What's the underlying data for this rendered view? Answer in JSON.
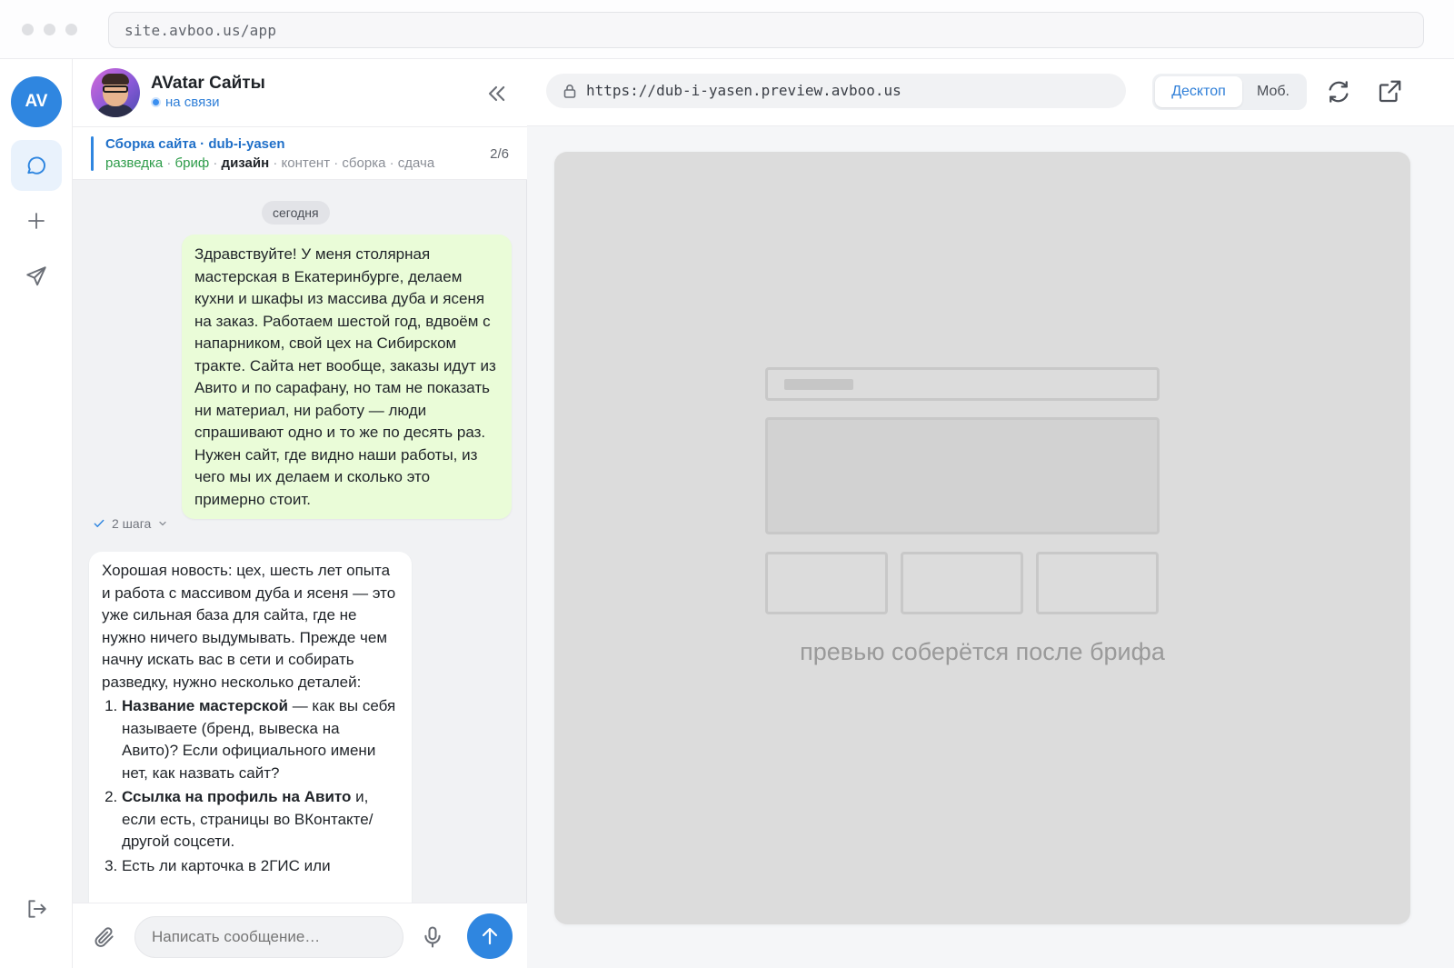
{
  "window": {
    "address": "site.avboo.us/app"
  },
  "rail": {
    "avatar_initials": "AV",
    "items": [
      {
        "icon": "chat-bubble-icon",
        "active": true
      },
      {
        "icon": "plus-icon",
        "active": false
      },
      {
        "icon": "send-plane-icon",
        "active": false
      }
    ],
    "bottom_icon": "logout-icon"
  },
  "chat": {
    "title": "AVatar Сайты",
    "status": "на связи",
    "collapse_icon": "double-chevron-left-icon",
    "project": {
      "title": "Сборка сайта · dub-i-yasen",
      "steps": [
        {
          "label": "разведка",
          "state": "done"
        },
        {
          "label": "бриф",
          "state": "done"
        },
        {
          "label": "дизайн",
          "state": "current"
        },
        {
          "label": "контент",
          "state": "todo"
        },
        {
          "label": "сборка",
          "state": "todo"
        },
        {
          "label": "сдача",
          "state": "todo"
        }
      ],
      "separator": " · ",
      "progress": "2/6"
    },
    "date_label": "сегодня",
    "outgoing_message": "Здравствуйте! У меня столярная мастерская в Екатеринбурге, делаем кухни и шкафы из массива дуба и ясеня на заказ. Работаем шестой год, вдвоём с напарником, свой цех на Сибирском тракте. Сайта нет вообще, заказы идут из Авито и по сарафану, но там не показать ни материал, ни работу — люди спрашивают одно и то же по десять раз. Нужен сайт, где видно наши работы, из чего мы их делаем и сколько это примерно стоит.",
    "steps_toggle": "2 шага",
    "incoming_message": {
      "intro": "Хорошая новость: цех, шесть лет опыта и работа с массивом дуба и ясеня — это уже сильная база для сайта, где не нужно ничего выдумывать. Прежде чем начну искать вас в сети и собирать разведку, нужно несколько деталей:",
      "items": [
        {
          "bold": "Название мастерской",
          "rest": " — как вы себя называете (бренд, вывеска на Авито)? Если официального имени нет, как назвать сайт?"
        },
        {
          "bold": "Ссылка на профиль на Авито",
          "rest": " и, если есть, страницы во ВКонтакте/другой соцсети."
        },
        {
          "bold": "",
          "rest": "Есть ли карточка в 2ГИС или"
        }
      ]
    },
    "composer": {
      "placeholder": "Написать сообщение…"
    }
  },
  "preview": {
    "url": "https://dub-i-yasen.preview.avboo.us",
    "modes": [
      "Десктоп",
      "Моб."
    ],
    "selected_mode": "Десктоп",
    "caption": "превью соберётся после брифа"
  },
  "colors": {
    "accent": "#2f86e0",
    "done_step": "#2e9c4a",
    "outgoing_bubble": "#eafcd8"
  }
}
